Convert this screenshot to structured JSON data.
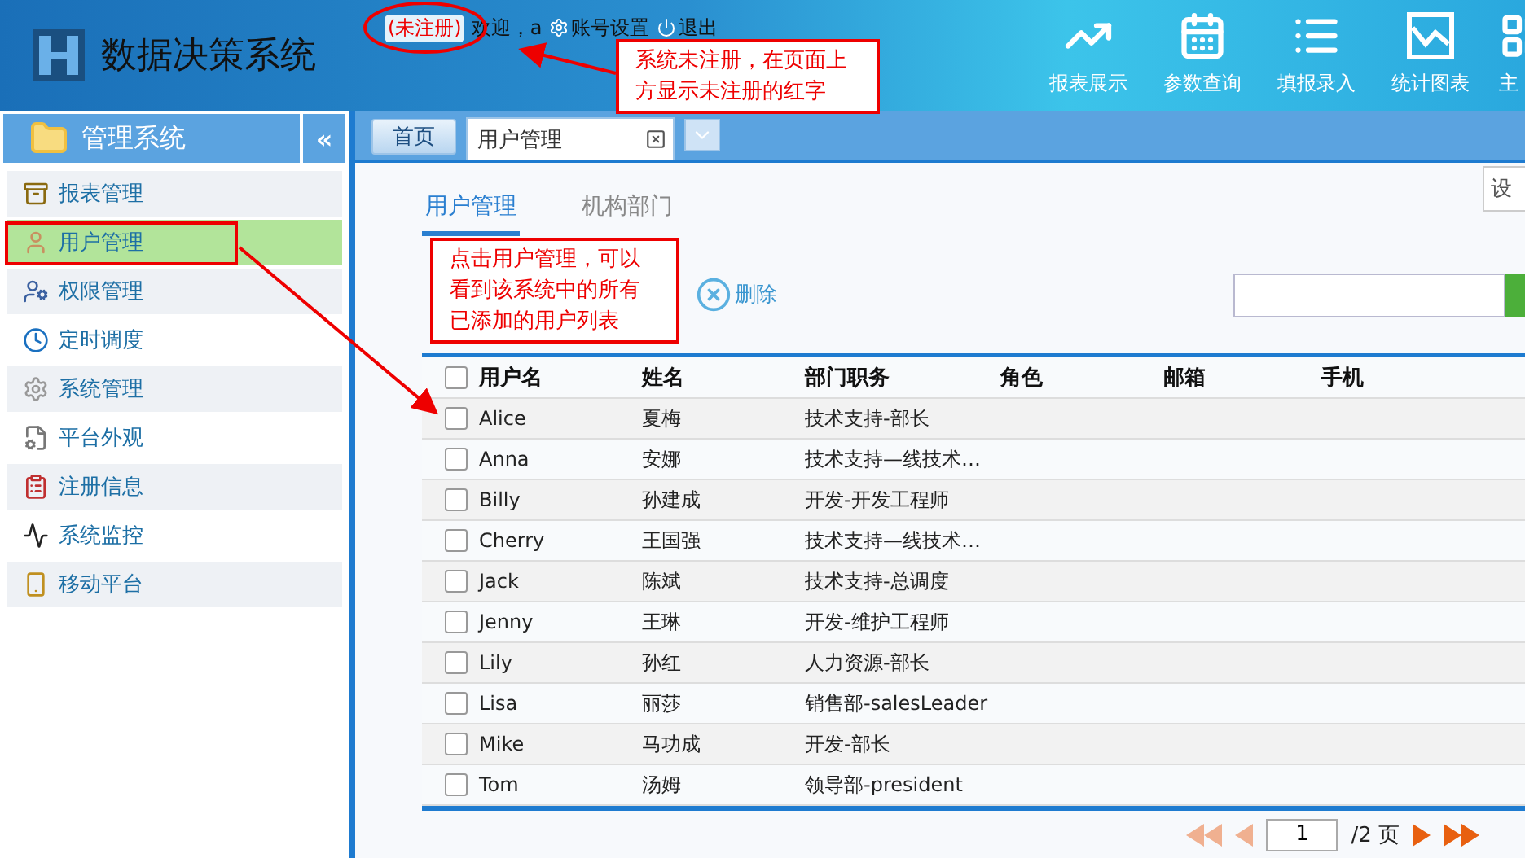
{
  "header": {
    "title": "数据决策系统",
    "unregistered": "(未注册)",
    "welcome": "欢迎，a",
    "account_settings": "账号设置",
    "logout": "退出",
    "nav": [
      {
        "label": "报表展示",
        "kind": "trend"
      },
      {
        "label": "参数查询",
        "kind": "calendar"
      },
      {
        "label": "填报录入",
        "kind": "list"
      },
      {
        "label": "统计图表",
        "kind": "chart"
      },
      {
        "label": "主",
        "kind": "partial"
      }
    ]
  },
  "sidebar": {
    "title": "管理系统",
    "collapse": "«",
    "items": [
      {
        "label": "报表管理",
        "kind": "cabinet",
        "selected": false
      },
      {
        "label": "用户管理",
        "kind": "user",
        "selected": true
      },
      {
        "label": "权限管理",
        "kind": "userkey",
        "selected": false
      },
      {
        "label": "定时调度",
        "kind": "clock",
        "selected": false
      },
      {
        "label": "系统管理",
        "kind": "gear",
        "selected": false
      },
      {
        "label": "平台外观",
        "kind": "page",
        "selected": false
      },
      {
        "label": "注册信息",
        "kind": "form",
        "selected": false
      },
      {
        "label": "系统监控",
        "kind": "monitor",
        "selected": false
      },
      {
        "label": "移动平台",
        "kind": "mobile",
        "selected": false
      }
    ]
  },
  "tabs": [
    {
      "label": "首页",
      "kind": "home",
      "selected": false
    },
    {
      "label": "用户管理",
      "kind": "page",
      "selected": true
    }
  ],
  "settings_button": "设",
  "subtabs": [
    {
      "label": "用户管理",
      "selected": true
    },
    {
      "label": "机构部门",
      "selected": false
    }
  ],
  "toolbar": {
    "delete": "删除"
  },
  "table": {
    "header_checked": false,
    "columns": [
      "用户名",
      "姓名",
      "部门职务",
      "角色",
      "邮箱",
      "手机"
    ],
    "rows": [
      {
        "username": "Alice",
        "name": "夏梅",
        "dept": "技术支持-部长",
        "checked": false
      },
      {
        "username": "Anna",
        "name": "安娜",
        "dept": "技术支持—线技术…",
        "checked": false
      },
      {
        "username": "Billy",
        "name": "孙建成",
        "dept": "开发-开发工程师",
        "checked": false
      },
      {
        "username": "Cherry",
        "name": "王国强",
        "dept": "技术支持—线技术…",
        "checked": false
      },
      {
        "username": "Jack",
        "name": "陈斌",
        "dept": "技术支持-总调度",
        "checked": false
      },
      {
        "username": "Jenny",
        "name": "王琳",
        "dept": "开发-维护工程师",
        "checked": false
      },
      {
        "username": "Lily",
        "name": "孙红",
        "dept": "人力资源-部长",
        "checked": false
      },
      {
        "username": "Lisa",
        "name": "丽莎",
        "dept": "销售部-salesLeader",
        "checked": false
      },
      {
        "username": "Mike",
        "name": "马功成",
        "dept": "开发-部长",
        "checked": false
      },
      {
        "username": "Tom",
        "name": "汤姆",
        "dept": "领导部-president",
        "checked": false
      }
    ]
  },
  "pagination": {
    "page": "1",
    "total": "/2 页"
  },
  "annotations": [
    {
      "text": "系统未注册，在页面上方显示未注册的红字"
    },
    {
      "text": "点击用户管理，可以看到该系统中的所有已添加的用户列表"
    }
  ]
}
